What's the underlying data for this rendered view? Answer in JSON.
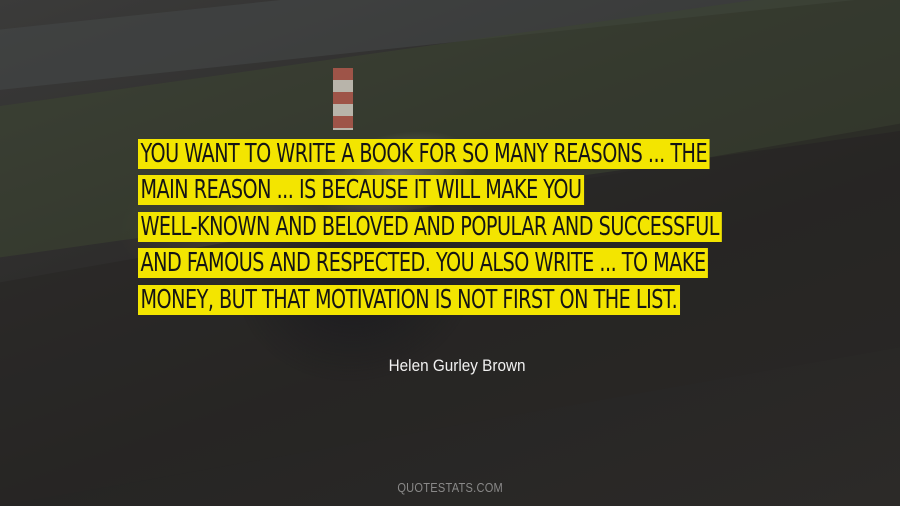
{
  "quote": {
    "lines": [
      "YOU WANT TO WRITE A BOOK FOR SO MANY REASONS ... THE",
      "MAIN REASON ... IS BECAUSE IT WILL MAKE YOU",
      "WELL-KNOWN AND BELOVED AND POPULAR AND SUCCESSFUL",
      "AND FAMOUS AND RESPECTED. YOU ALSO WRITE ... TO MAKE",
      "MONEY, BUT THAT MOTIVATION IS NOT FIRST ON THE LIST."
    ],
    "highlight_color": "#f3e500",
    "text_color": "#141414"
  },
  "author": {
    "name": "Helen Gurley Brown"
  },
  "watermark": {
    "text": "QUOTESTATS.COM"
  }
}
